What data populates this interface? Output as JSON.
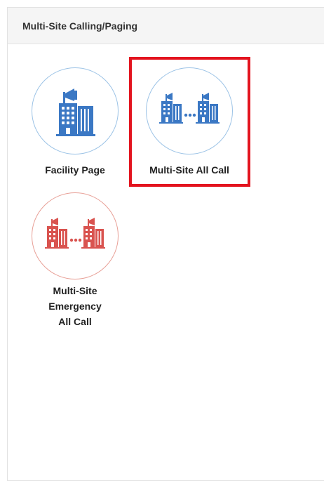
{
  "panel": {
    "title": "Multi-Site Calling/Paging"
  },
  "tiles": [
    {
      "label": "Facility Page",
      "icon": "facility-page-icon",
      "color": "#3b78c4"
    },
    {
      "label": "Multi-Site All Call",
      "icon": "multi-site-all-call-icon",
      "color": "#3b78c4",
      "highlighted": true
    },
    {
      "label_lines": [
        "Multi-Site",
        "Emergency",
        "All Call"
      ],
      "icon": "multi-site-emergency-all-call-icon",
      "color": "#d9534f"
    }
  ],
  "colors": {
    "highlight": "#e3141f",
    "icon_blue": "#3b78c4",
    "icon_red": "#d9534f"
  }
}
